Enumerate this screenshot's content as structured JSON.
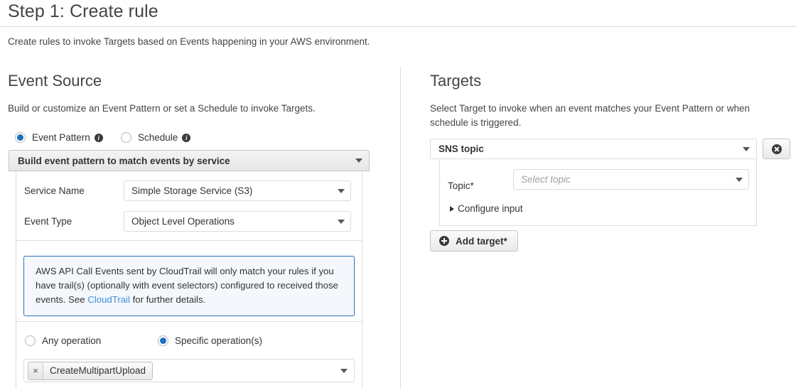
{
  "page": {
    "title": "Step 1: Create rule",
    "subtitle": "Create rules to invoke Targets based on Events happening in your AWS environment."
  },
  "event_source": {
    "heading": "Event Source",
    "description": "Build or customize an Event Pattern or set a Schedule to invoke Targets.",
    "mode_options": [
      {
        "label": "Event Pattern",
        "selected": true,
        "info_glyph": "i"
      },
      {
        "label": "Schedule",
        "selected": false,
        "info_glyph": "i"
      }
    ],
    "pattern_header": "Build event pattern to match events by service",
    "fields": [
      {
        "label": "Service Name",
        "value": "Simple Storage Service (S3)"
      },
      {
        "label": "Event Type",
        "value": "Object Level Operations"
      }
    ],
    "callout": {
      "text_before": "AWS API Call Events sent by CloudTrail will only match your rules if you have trail(s) (optionally with event selectors) configured to received those events. See ",
      "link": "CloudTrail",
      "text_after": " for further details.",
      "border_color": "#2f6fb0",
      "background_color": "#f4f8fd",
      "link_color": "#3f8ddb"
    },
    "operation_options": [
      {
        "label": "Any operation",
        "selected": false
      },
      {
        "label": "Specific operation(s)",
        "selected": true
      }
    ],
    "operations_field": {
      "chips": [
        {
          "remove_glyph": "×",
          "label": "CreateMultipartUpload"
        }
      ]
    }
  },
  "targets": {
    "heading": "Targets",
    "description": "Select Target to invoke when an event matches your Event Pattern or when schedule is triggered.",
    "target_type": "SNS topic",
    "remove_target_label": "",
    "topic_label": "Topic*",
    "topic_placeholder": "Select topic",
    "configure_input_label": "Configure input",
    "add_target_label": "Add target*"
  },
  "colors": {
    "accent": "#1a6fc4",
    "text": "#333333",
    "border": "#dcdcdc"
  }
}
